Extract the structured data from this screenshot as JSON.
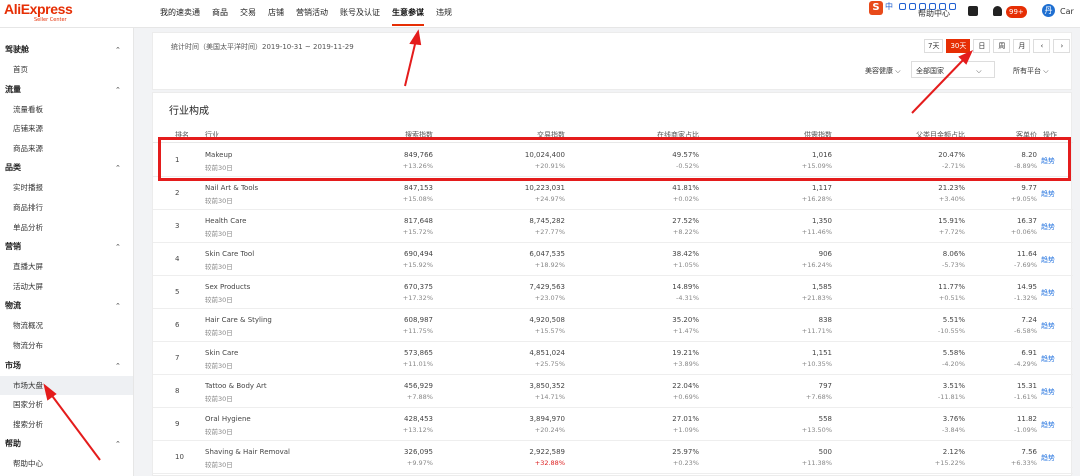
{
  "header": {
    "brand": "AliExpress",
    "brand_sub": "Seller Center",
    "nav": [
      "我的速卖通",
      "商品",
      "交易",
      "店铺",
      "营销活动",
      "账号及认证",
      "生意参谋",
      "违规"
    ],
    "active_nav": "生意参谋",
    "ext_text": "中",
    "help_label": "帮助中心",
    "badge": "99+",
    "avatar_letter": "丹",
    "user_label": "Car"
  },
  "sidebar": [
    {
      "group": "驾驶舱",
      "items": [
        {
          "label": "首页",
          "active": false
        }
      ]
    },
    {
      "group": "流量",
      "items": [
        {
          "label": "流量看板",
          "active": false
        },
        {
          "label": "店铺来源",
          "active": false
        },
        {
          "label": "商品来源",
          "active": false
        }
      ]
    },
    {
      "group": "品类",
      "items": [
        {
          "label": "实时播报",
          "active": false
        },
        {
          "label": "商品排行",
          "active": false
        },
        {
          "label": "单品分析",
          "active": false
        }
      ]
    },
    {
      "group": "营销",
      "items": [
        {
          "label": "直播大屏",
          "active": false
        },
        {
          "label": "活动大屏",
          "active": false
        }
      ]
    },
    {
      "group": "物流",
      "items": [
        {
          "label": "物流概况",
          "active": false
        },
        {
          "label": "物流分布",
          "active": false
        }
      ]
    },
    {
      "group": "市场",
      "items": [
        {
          "label": "市场大盘",
          "active": true
        },
        {
          "label": "国家分析",
          "active": false
        },
        {
          "label": "搜索分析",
          "active": false
        }
      ]
    },
    {
      "group": "帮助",
      "items": [
        {
          "label": "帮助中心",
          "active": false
        }
      ]
    }
  ],
  "filters": {
    "stat_time": "统计时间（美国太平洋时间）2019-10-31 ~ 2019-11-29",
    "periods": [
      "7天",
      "30天",
      "日",
      "周",
      "月"
    ],
    "active_period": "30天",
    "category": "美容健康",
    "scope": "全部国家",
    "platform": "所有平台"
  },
  "table": {
    "title": "行业构成",
    "headers": [
      "排名",
      "行业",
      "搜索指数",
      "交易指数",
      "在线商家占比",
      "供需指数",
      "父类目金额占比",
      "客单价",
      "操作"
    ],
    "compare_label": "较前30日",
    "action_label": "趋势",
    "rows": [
      {
        "rank": "1",
        "industry": "Makeup",
        "search": "849,766",
        "search_chg": "+13.26%",
        "trade": "10,024,400",
        "trade_chg": "+20.91%",
        "seller": "49.57%",
        "seller_chg": "-0.52%",
        "supply": "1,016",
        "supply_chg": "+15.09%",
        "share": "20.47%",
        "share_chg": "-2.71%",
        "price": "8.20",
        "price_chg": "-8.89%"
      },
      {
        "rank": "2",
        "industry": "Nail Art & Tools",
        "search": "847,153",
        "search_chg": "+15.08%",
        "trade": "10,223,031",
        "trade_chg": "+24.97%",
        "seller": "41.81%",
        "seller_chg": "+0.02%",
        "supply": "1,117",
        "supply_chg": "+16.28%",
        "share": "21.23%",
        "share_chg": "+3.40%",
        "price": "9.77",
        "price_chg": "+9.05%"
      },
      {
        "rank": "3",
        "industry": "Health Care",
        "search": "817,648",
        "search_chg": "+15.72%",
        "trade": "8,745,282",
        "trade_chg": "+27.77%",
        "seller": "27.52%",
        "seller_chg": "+8.22%",
        "supply": "1,350",
        "supply_chg": "+11.46%",
        "share": "15.91%",
        "share_chg": "+7.72%",
        "price": "16.37",
        "price_chg": "+0.06%"
      },
      {
        "rank": "4",
        "industry": "Skin Care Tool",
        "search": "690,494",
        "search_chg": "+15.92%",
        "trade": "6,047,535",
        "trade_chg": "+18.92%",
        "seller": "38.42%",
        "seller_chg": "+1.05%",
        "supply": "906",
        "supply_chg": "+16.24%",
        "share": "8.06%",
        "share_chg": "-5.73%",
        "price": "11.64",
        "price_chg": "-7.69%"
      },
      {
        "rank": "5",
        "industry": "Sex Products",
        "search": "670,375",
        "search_chg": "+17.32%",
        "trade": "7,429,563",
        "trade_chg": "+23.07%",
        "seller": "14.89%",
        "seller_chg": "-4.31%",
        "supply": "1,585",
        "supply_chg": "+21.83%",
        "share": "11.77%",
        "share_chg": "+0.51%",
        "price": "14.95",
        "price_chg": "-1.32%"
      },
      {
        "rank": "6",
        "industry": "Hair Care & Styling",
        "search": "608,987",
        "search_chg": "+11.75%",
        "trade": "4,920,508",
        "trade_chg": "+15.57%",
        "seller": "35.20%",
        "seller_chg": "+1.47%",
        "supply": "838",
        "supply_chg": "+11.71%",
        "share": "5.51%",
        "share_chg": "-10.55%",
        "price": "7.24",
        "price_chg": "-6.58%"
      },
      {
        "rank": "7",
        "industry": "Skin Care",
        "search": "573,865",
        "search_chg": "+11.01%",
        "trade": "4,851,024",
        "trade_chg": "+25.75%",
        "seller": "19.21%",
        "seller_chg": "+3.89%",
        "supply": "1,151",
        "supply_chg": "+10.35%",
        "share": "5.58%",
        "share_chg": "-4.20%",
        "price": "6.91",
        "price_chg": "-4.29%"
      },
      {
        "rank": "8",
        "industry": "Tattoo & Body Art",
        "search": "456,929",
        "search_chg": "+7.88%",
        "trade": "3,850,352",
        "trade_chg": "+14.71%",
        "seller": "22.04%",
        "seller_chg": "+0.69%",
        "supply": "797",
        "supply_chg": "+7.68%",
        "share": "3.51%",
        "share_chg": "-11.81%",
        "price": "15.31",
        "price_chg": "-1.61%"
      },
      {
        "rank": "9",
        "industry": "Oral Hygiene",
        "search": "428,453",
        "search_chg": "+13.12%",
        "trade": "3,894,970",
        "trade_chg": "+20.24%",
        "seller": "27.01%",
        "seller_chg": "+1.09%",
        "supply": "558",
        "supply_chg": "+13.50%",
        "share": "3.76%",
        "share_chg": "-3.84%",
        "price": "11.82",
        "price_chg": "-1.09%"
      },
      {
        "rank": "10",
        "industry": "Shaving & Hair Removal",
        "search": "326,095",
        "search_chg": "+9.97%",
        "trade": "2,922,589",
        "trade_chg": "+32.88%",
        "seller": "25.97%",
        "seller_chg": "+0.23%",
        "supply": "500",
        "supply_chg": "+11.38%",
        "share": "2.12%",
        "share_chg": "+15.22%",
        "price": "7.56",
        "price_chg": "+6.33%"
      }
    ]
  },
  "colors": {
    "accent": "#e62e04",
    "highlight": "#e41c1c",
    "link": "#2a77e0"
  }
}
